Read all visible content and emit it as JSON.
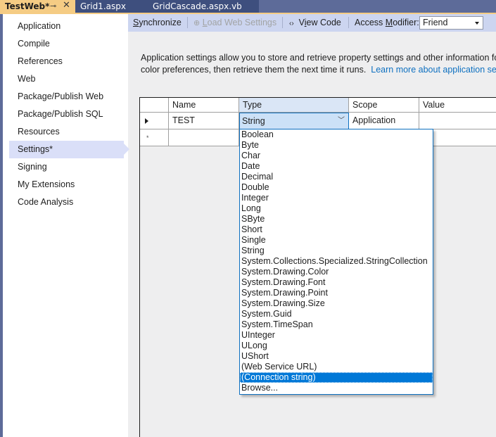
{
  "tabs": [
    {
      "label": "TestWeb*",
      "active": true,
      "pin_icon": "pin-icon",
      "close_icon": "close-icon"
    },
    {
      "label": "Grid1.aspx",
      "active": false
    },
    {
      "label": "GridCascade.aspx.vb",
      "active": false
    }
  ],
  "sidebar": {
    "items": [
      {
        "label": "Application"
      },
      {
        "label": "Compile"
      },
      {
        "label": "References"
      },
      {
        "label": "Web"
      },
      {
        "label": "Package/Publish Web"
      },
      {
        "label": "Package/Publish SQL"
      },
      {
        "label": "Resources"
      },
      {
        "label": "Settings*",
        "selected": true
      },
      {
        "label": "Signing"
      },
      {
        "label": "My Extensions"
      },
      {
        "label": "Code Analysis"
      }
    ]
  },
  "toolbar": {
    "synchronize": {
      "accel": "S",
      "rest": "ynchronize"
    },
    "load_web_settings": {
      "accel": "L",
      "rest": "oad Web Settings",
      "enabled": false
    },
    "view_code": {
      "pre": "V",
      "accel": "i",
      "rest": "ew Code"
    },
    "access_modifier": {
      "pre": "Access ",
      "accel": "M",
      "rest": "odifier:"
    },
    "access_modifier_value": "Friend"
  },
  "description": {
    "line1": "Application settings allow you to store and retrieve property settings and other information for your application dynamically. For example, the application can save a user's",
    "line2": "color preferences, then retrieve them the next time it runs.",
    "link": "Learn more about application settings..."
  },
  "grid": {
    "columns": [
      "Name",
      "Type",
      "Scope",
      "Value"
    ],
    "rows": [
      {
        "name": "TEST",
        "type": "String",
        "scope": "Application",
        "value": ""
      }
    ],
    "new_row_marker": "*"
  },
  "type_dropdown": {
    "selected": "(Connection string)",
    "options": [
      "Boolean",
      "Byte",
      "Char",
      "Date",
      "Decimal",
      "Double",
      "Integer",
      "Long",
      "SByte",
      "Short",
      "Single",
      "String",
      "System.Collections.Specialized.StringCollection",
      "System.Drawing.Color",
      "System.Drawing.Font",
      "System.Drawing.Point",
      "System.Drawing.Size",
      "System.Guid",
      "System.TimeSpan",
      "UInteger",
      "ULong",
      "UShort",
      "(Web Service URL)",
      "(Connection string)",
      "Browse..."
    ]
  },
  "colors": {
    "tab_active": "#f5cc84",
    "tab_inactive": "#3e4f7e",
    "tabbar": "#5d6b99",
    "toolbar": "#ccd5f0",
    "selection": "#0078d7",
    "link": "#0e70c0"
  }
}
